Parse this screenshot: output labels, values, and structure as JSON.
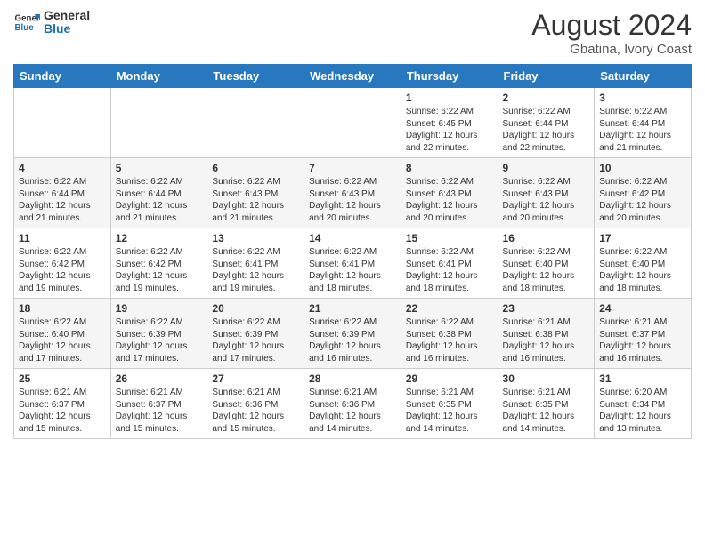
{
  "header": {
    "logo_general": "General",
    "logo_blue": "Blue",
    "month_year": "August 2024",
    "location": "Gbatina, Ivory Coast"
  },
  "days_of_week": [
    "Sunday",
    "Monday",
    "Tuesday",
    "Wednesday",
    "Thursday",
    "Friday",
    "Saturday"
  ],
  "weeks": [
    [
      {
        "day": "",
        "text": ""
      },
      {
        "day": "",
        "text": ""
      },
      {
        "day": "",
        "text": ""
      },
      {
        "day": "",
        "text": ""
      },
      {
        "day": "1",
        "text": "Sunrise: 6:22 AM\nSunset: 6:45 PM\nDaylight: 12 hours\nand 22 minutes."
      },
      {
        "day": "2",
        "text": "Sunrise: 6:22 AM\nSunset: 6:44 PM\nDaylight: 12 hours\nand 22 minutes."
      },
      {
        "day": "3",
        "text": "Sunrise: 6:22 AM\nSunset: 6:44 PM\nDaylight: 12 hours\nand 21 minutes."
      }
    ],
    [
      {
        "day": "4",
        "text": "Sunrise: 6:22 AM\nSunset: 6:44 PM\nDaylight: 12 hours\nand 21 minutes."
      },
      {
        "day": "5",
        "text": "Sunrise: 6:22 AM\nSunset: 6:44 PM\nDaylight: 12 hours\nand 21 minutes."
      },
      {
        "day": "6",
        "text": "Sunrise: 6:22 AM\nSunset: 6:43 PM\nDaylight: 12 hours\nand 21 minutes."
      },
      {
        "day": "7",
        "text": "Sunrise: 6:22 AM\nSunset: 6:43 PM\nDaylight: 12 hours\nand 20 minutes."
      },
      {
        "day": "8",
        "text": "Sunrise: 6:22 AM\nSunset: 6:43 PM\nDaylight: 12 hours\nand 20 minutes."
      },
      {
        "day": "9",
        "text": "Sunrise: 6:22 AM\nSunset: 6:43 PM\nDaylight: 12 hours\nand 20 minutes."
      },
      {
        "day": "10",
        "text": "Sunrise: 6:22 AM\nSunset: 6:42 PM\nDaylight: 12 hours\nand 20 minutes."
      }
    ],
    [
      {
        "day": "11",
        "text": "Sunrise: 6:22 AM\nSunset: 6:42 PM\nDaylight: 12 hours\nand 19 minutes."
      },
      {
        "day": "12",
        "text": "Sunrise: 6:22 AM\nSunset: 6:42 PM\nDaylight: 12 hours\nand 19 minutes."
      },
      {
        "day": "13",
        "text": "Sunrise: 6:22 AM\nSunset: 6:41 PM\nDaylight: 12 hours\nand 19 minutes."
      },
      {
        "day": "14",
        "text": "Sunrise: 6:22 AM\nSunset: 6:41 PM\nDaylight: 12 hours\nand 18 minutes."
      },
      {
        "day": "15",
        "text": "Sunrise: 6:22 AM\nSunset: 6:41 PM\nDaylight: 12 hours\nand 18 minutes."
      },
      {
        "day": "16",
        "text": "Sunrise: 6:22 AM\nSunset: 6:40 PM\nDaylight: 12 hours\nand 18 minutes."
      },
      {
        "day": "17",
        "text": "Sunrise: 6:22 AM\nSunset: 6:40 PM\nDaylight: 12 hours\nand 18 minutes."
      }
    ],
    [
      {
        "day": "18",
        "text": "Sunrise: 6:22 AM\nSunset: 6:40 PM\nDaylight: 12 hours\nand 17 minutes."
      },
      {
        "day": "19",
        "text": "Sunrise: 6:22 AM\nSunset: 6:39 PM\nDaylight: 12 hours\nand 17 minutes."
      },
      {
        "day": "20",
        "text": "Sunrise: 6:22 AM\nSunset: 6:39 PM\nDaylight: 12 hours\nand 17 minutes."
      },
      {
        "day": "21",
        "text": "Sunrise: 6:22 AM\nSunset: 6:39 PM\nDaylight: 12 hours\nand 16 minutes."
      },
      {
        "day": "22",
        "text": "Sunrise: 6:22 AM\nSunset: 6:38 PM\nDaylight: 12 hours\nand 16 minutes."
      },
      {
        "day": "23",
        "text": "Sunrise: 6:21 AM\nSunset: 6:38 PM\nDaylight: 12 hours\nand 16 minutes."
      },
      {
        "day": "24",
        "text": "Sunrise: 6:21 AM\nSunset: 6:37 PM\nDaylight: 12 hours\nand 16 minutes."
      }
    ],
    [
      {
        "day": "25",
        "text": "Sunrise: 6:21 AM\nSunset: 6:37 PM\nDaylight: 12 hours\nand 15 minutes."
      },
      {
        "day": "26",
        "text": "Sunrise: 6:21 AM\nSunset: 6:37 PM\nDaylight: 12 hours\nand 15 minutes."
      },
      {
        "day": "27",
        "text": "Sunrise: 6:21 AM\nSunset: 6:36 PM\nDaylight: 12 hours\nand 15 minutes."
      },
      {
        "day": "28",
        "text": "Sunrise: 6:21 AM\nSunset: 6:36 PM\nDaylight: 12 hours\nand 14 minutes."
      },
      {
        "day": "29",
        "text": "Sunrise: 6:21 AM\nSunset: 6:35 PM\nDaylight: 12 hours\nand 14 minutes."
      },
      {
        "day": "30",
        "text": "Sunrise: 6:21 AM\nSunset: 6:35 PM\nDaylight: 12 hours\nand 14 minutes."
      },
      {
        "day": "31",
        "text": "Sunrise: 6:20 AM\nSunset: 6:34 PM\nDaylight: 12 hours\nand 13 minutes."
      }
    ]
  ]
}
